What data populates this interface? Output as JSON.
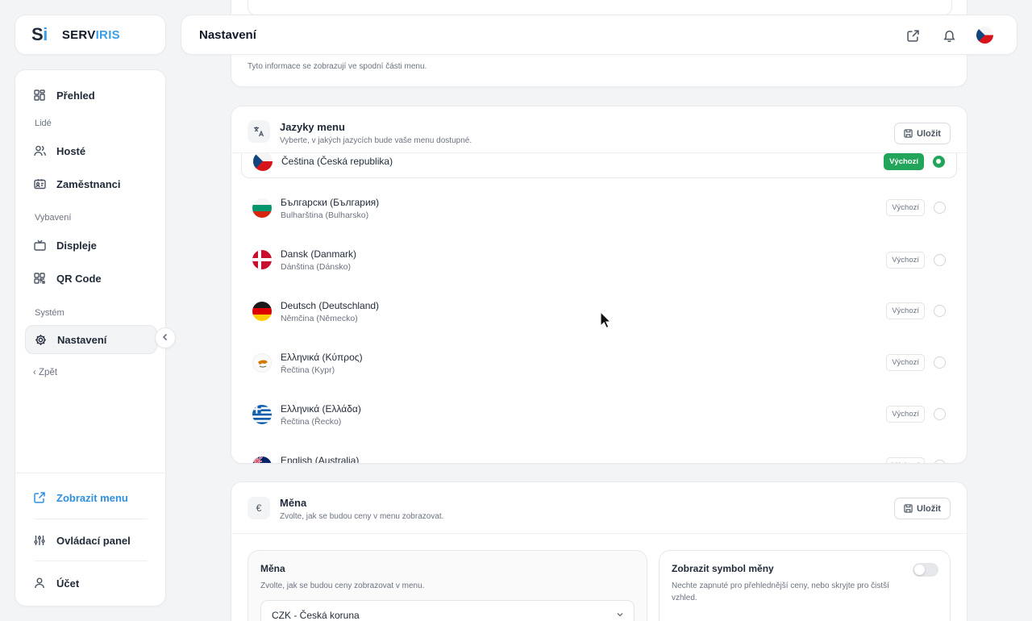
{
  "logo": {
    "mark_s": "S",
    "mark_i": "i",
    "text_a": "SERV",
    "text_b": "IRIS"
  },
  "sidebar": {
    "overview": "Přehled",
    "section_people": "Lidé",
    "guests": "Hosté",
    "employees": "Zaměstnanci",
    "section_equipment": "Vybavení",
    "displays": "Displeje",
    "qr": "QR Code",
    "section_system": "Systém",
    "settings": "Nastavení",
    "back": "Zpět",
    "show_menu": "Zobrazit menu",
    "control_panel": "Ovládací panel",
    "account": "Účet"
  },
  "header": {
    "title": "Nastavení"
  },
  "top_card": {
    "hint": "Tyto informace se zobrazují ve spodní části menu."
  },
  "languages": {
    "title": "Jazyky menu",
    "subtitle": "Vyberte, v jakých jazycích bude vaše menu dostupné.",
    "save_label": "Uložit",
    "default_label": "Výchozí",
    "items": [
      {
        "name": "Čeština (Česká republika)",
        "sub": "",
        "default": true
      },
      {
        "name": "Български (България)",
        "sub": "Bulharština (Bulharsko)",
        "default": false
      },
      {
        "name": "Dansk (Danmark)",
        "sub": "Dánština (Dánsko)",
        "default": false
      },
      {
        "name": "Deutsch (Deutschland)",
        "sub": "Němčina (Německo)",
        "default": false
      },
      {
        "name": "Ελληνικά (Κύπρος)",
        "sub": "Řečtina (Kypr)",
        "default": false
      },
      {
        "name": "Ελληνικά (Ελλάδα)",
        "sub": "Řečtina (Řecko)",
        "default": false
      },
      {
        "name": "English (Australia)",
        "sub": "",
        "default": false
      }
    ]
  },
  "currency": {
    "icon": "€",
    "title": "Měna",
    "subtitle": "Zvolte, jak se budou ceny v menu zobrazovat.",
    "save_label": "Uložit",
    "panel_title": "Měna",
    "panel_sub": "Zvolte, jak se budou ceny zobrazovat v menu.",
    "selected": "CZK - Česká koruna",
    "symbol_title": "Zobrazit symbol měny",
    "symbol_sub": "Nechte zapnuté pro přehlednější ceny, nebo skryjte pro čistší vzhled.",
    "symbol_on": false
  },
  "colors": {
    "accent": "#3b9ee8",
    "success": "#22a55a"
  }
}
